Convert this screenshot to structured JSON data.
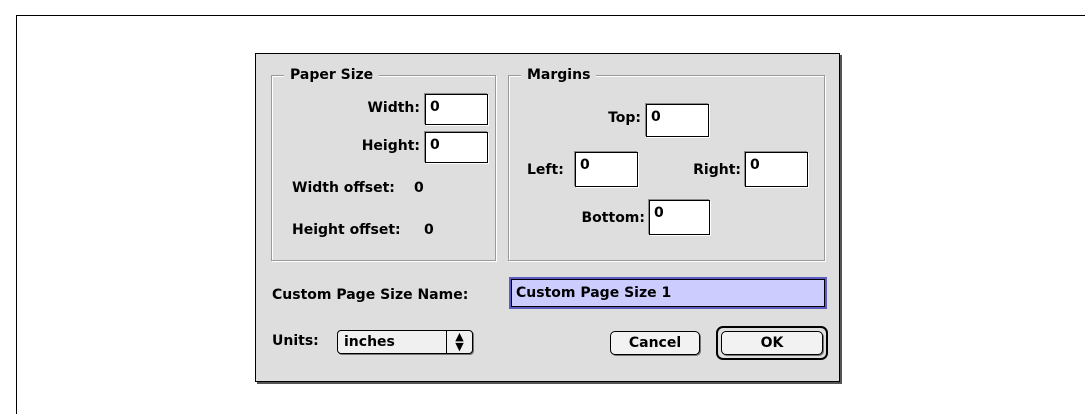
{
  "dialog": {
    "paper_size": {
      "title": "Paper Size",
      "width_label": "Width:",
      "width_value": "0",
      "height_label": "Height:",
      "height_value": "0",
      "width_offset_label": "Width offset:",
      "width_offset_value": "0",
      "height_offset_label": "Height offset:",
      "height_offset_value": "0"
    },
    "margins": {
      "title": "Margins",
      "top_label": "Top:",
      "top_value": "0",
      "left_label": "Left:",
      "left_value": "0",
      "right_label": "Right:",
      "right_value": "0",
      "bottom_label": "Bottom:",
      "bottom_value": "0"
    },
    "custom_name": {
      "label": "Custom Page Size Name:",
      "value": "Custom Page Size 1"
    },
    "units": {
      "label": "Units:",
      "selected": "inches",
      "arrows_icon": "up-down-arrows-icon"
    },
    "buttons": {
      "cancel": "Cancel",
      "ok": "OK"
    },
    "colors": {
      "dialog_bg": "#dedede",
      "selection_bg": "#ccccff",
      "focus_ring": "#5b5bc2"
    }
  }
}
